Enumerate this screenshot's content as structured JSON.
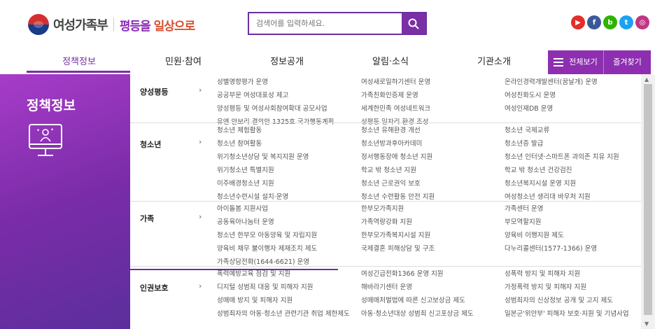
{
  "header": {
    "ministry": "여성가족부",
    "slogan_pre": "평등을 ",
    "slogan_hl": "일상으로",
    "search_placeholder": "검색어를 입력하세요.",
    "social": [
      {
        "name": "youtube",
        "color": "#e52d27",
        "glyph": "▶"
      },
      {
        "name": "facebook",
        "color": "#3b5998",
        "glyph": "f"
      },
      {
        "name": "blog",
        "color": "#2db400",
        "glyph": "b"
      },
      {
        "name": "twitter",
        "color": "#1da1f2",
        "glyph": "t"
      },
      {
        "name": "instagram",
        "color": "#c13584",
        "glyph": "◎"
      }
    ]
  },
  "gnb": {
    "items": [
      "정책정보",
      "민원·참여",
      "정보공개",
      "알림·소식",
      "기관소개"
    ],
    "all_view": "전체보기",
    "favorites": "즐겨찾기"
  },
  "side": {
    "title": "정책정보"
  },
  "categories": [
    {
      "name": "양성평등",
      "cols": [
        [
          "성별영향평가 운영",
          "공공부문 여성대표성 제고",
          "양성평등 및 여성사회참여확대 공모사업",
          "유엔 안보리 결의안 1325호 국가행동계획"
        ],
        [
          "여성새로일하기센터 운영",
          "가족친화인증제 운영",
          "세계한민족 여성네트워크",
          "성평등 일자리 환경 조성"
        ],
        [
          "온라인경력개발센터(꿈날개) 운영",
          "여성친화도시 운영",
          "여성인재DB 운영"
        ]
      ]
    },
    {
      "name": "청소년",
      "cols": [
        [
          "청소년 체험활동",
          "청소년 참여활동",
          "위기청소년상담 및 복지지원 운영",
          "위기청소년 특별지원",
          "이주배경청소년 지원",
          "청소년수련시설 설치·운영"
        ],
        [
          "청소년 유해환경 개선",
          "청소년방과후아카데미",
          "정서행동장애 청소년 지원",
          "학교 밖 청소년 지원",
          "청소년 근로권익 보호",
          "청소년 수련활동 안전 지원"
        ],
        [
          "청소년 국제교류",
          "청소년증 발급",
          "청소년 인터넷·스마트폰 과의존 치유 지원",
          "학교 밖 청소년 건강검진",
          "청소년복지시설 운영 지원",
          "여성청소년 생리대 바우처 지원"
        ]
      ]
    },
    {
      "name": "가족",
      "cols": [
        [
          "아이돌봄 지원사업",
          "공동육아나눔터 운영",
          "청소년 한부모 아동양육 및 자립지원",
          "양육비 채무 불이행자 제재조치 제도",
          "가족상담전화(1644-6621) 운영"
        ],
        [
          "한부모가족지원",
          "가족역량강화 지원",
          "한부모가족복지시설 지원",
          "국제결혼 피해상담 및 구조"
        ],
        [
          "가족센터 운영",
          "부모역할지원",
          "양육비 이행지원 제도",
          "다누리콜센터(1577-1366) 운영"
        ]
      ]
    },
    {
      "name": "인권보호",
      "cols": [
        [
          "폭력예방교육 점검 및 지원",
          "디지털 성범죄 대응 및 피해자 지원",
          "성매매 방지 및 피해자 지원",
          "성범죄자의 아동·청소년 관련기관 취업 제한제도"
        ],
        [
          "여성긴급전화1366 운영 지원",
          "해바라기센터 운영",
          "성매매처벌법에 따른 신고보상금 제도",
          "아동·청소년대상 성범죄 신고포상금 제도"
        ],
        [
          "성폭력 방지 및 피해자 지원",
          "가정폭력 방지 및 피해자 지원",
          "성범죄자의 신상정보 공개 및 고지 제도",
          "일본군'위안부' 피해자 보호·지원 및 기념사업"
        ]
      ]
    }
  ]
}
